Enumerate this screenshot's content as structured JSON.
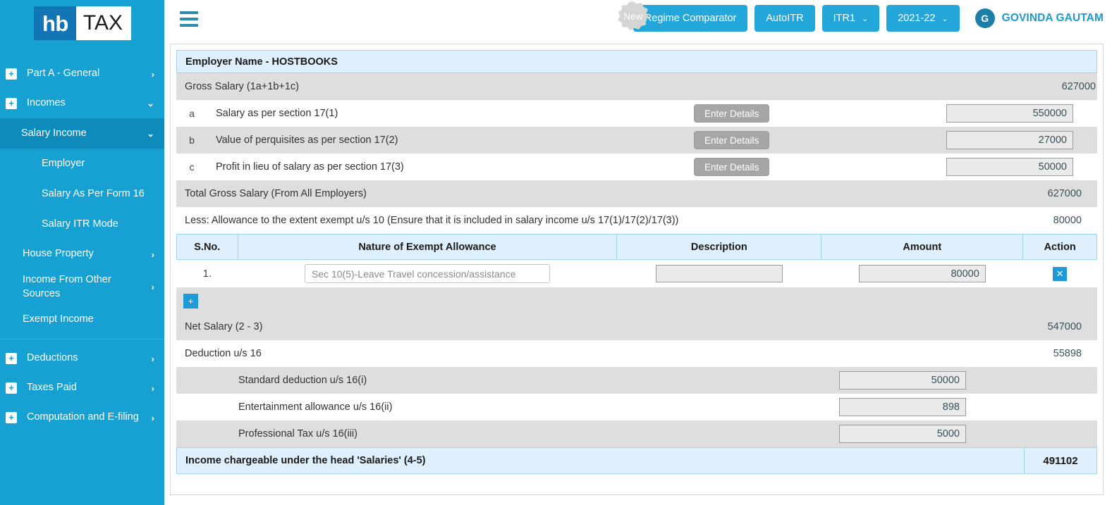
{
  "brand": {
    "logo_primary": "hb",
    "logo_secondary": "TAX",
    "accent": "#17a0d2",
    "button_blue": "#23a7da"
  },
  "sidebar": {
    "items": [
      {
        "label": "Part A - General",
        "level": 1,
        "expander": "+",
        "chevron": "›"
      },
      {
        "label": "Incomes",
        "level": 1,
        "expander": "+",
        "chevron": "⌄"
      },
      {
        "label": "Salary Income",
        "level": 2,
        "expander": "",
        "chevron": "⌄"
      },
      {
        "label": "Employer",
        "level": 3,
        "expander": "",
        "chevron": ""
      },
      {
        "label": "Salary As Per Form 16",
        "level": 3,
        "expander": "",
        "chevron": ""
      },
      {
        "label": "Salary ITR Mode",
        "level": 3,
        "expander": "",
        "chevron": ""
      },
      {
        "label": "House Property",
        "level": 2,
        "expander": "",
        "chevron": "›"
      },
      {
        "label": "Income From Other Sources",
        "level": 2,
        "expander": "",
        "chevron": "›"
      },
      {
        "label": "Exempt Income",
        "level": 2,
        "expander": "",
        "chevron": ""
      },
      {
        "label": "Deductions",
        "level": 1,
        "expander": "+",
        "chevron": "›"
      },
      {
        "label": "Taxes Paid",
        "level": 1,
        "expander": "+",
        "chevron": "›"
      },
      {
        "label": "Computation and E-filing",
        "level": 1,
        "expander": "+",
        "chevron": "›"
      }
    ]
  },
  "topbar": {
    "new_badge": "New",
    "regime_comparator": "Regime Comparator",
    "auto_itr": "AutoITR",
    "itr_form": "ITR1",
    "assessment_year": "2021-22",
    "caret": "⌄",
    "user_initial": "G",
    "user_name": "GOVINDA GAUTAM"
  },
  "form": {
    "employer_header": "Employer Name - HOSTBOOKS",
    "gross_salary_label": "Gross Salary (1a+1b+1c)",
    "gross_salary_value": "627000",
    "enter_details_label": "Enter Details",
    "rows": [
      {
        "idx": "a",
        "label": "Salary as per section 17(1)",
        "value": "550000"
      },
      {
        "idx": "b",
        "label": "Value of perquisites as per section 17(2)",
        "value": "27000"
      },
      {
        "idx": "c",
        "label": "Profit in lieu of salary as per section 17(3)",
        "value": "50000"
      }
    ],
    "total_gross_label": "Total Gross Salary (From All Employers)",
    "total_gross_value": "627000",
    "less_allowance_label": "Less: Allowance to the extent exempt u/s 10 (Ensure that it is included in salary income u/s 17(1)/17(2)/17(3))",
    "less_allowance_value": "80000",
    "exempt_table": {
      "headers": [
        "S.No.",
        "Nature of Exempt Allowance",
        "Description",
        "Amount",
        "Action"
      ],
      "rows": [
        {
          "sno": "1.",
          "nature": "Sec 10(5)-Leave Travel concession/assistance",
          "description": "",
          "amount": "80000",
          "action": "✕"
        }
      ],
      "add_label": "+"
    },
    "net_salary_label": "Net Salary (2 - 3)",
    "net_salary_value": "547000",
    "deduction16_label": "Deduction u/s 16",
    "deduction16_value": "55898",
    "deduction_rows": [
      {
        "label": "Standard deduction u/s 16(i)",
        "value": "50000"
      },
      {
        "label": "Entertainment allowance u/s 16(ii)",
        "value": "898"
      },
      {
        "label": "Professional Tax u/s 16(iii)",
        "value": "5000"
      }
    ],
    "chargeable_label": "Income chargeable under the head 'Salaries' (4-5)",
    "chargeable_value": "491102"
  }
}
